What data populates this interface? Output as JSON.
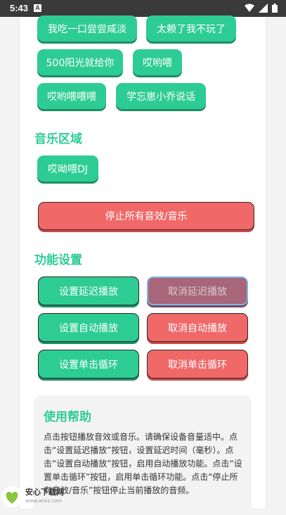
{
  "status_bar": {
    "time": "5:43",
    "notif_glyph": "A"
  },
  "sound_chips": [
    {
      "label": "我吃一口尝尝咸淡"
    },
    {
      "label": "太赖了我不玩了"
    },
    {
      "label": "500阳光就给你"
    },
    {
      "label": "哎哟喂"
    },
    {
      "label": "哎哟喂喂喂"
    },
    {
      "label": "学忘崽小乔说话"
    }
  ],
  "music_section": {
    "title": "音乐区域",
    "chips": [
      {
        "label": "哎呦喂DJ"
      }
    ],
    "stop_label": "停止所有音效/音乐"
  },
  "settings_section": {
    "title": "功能设置",
    "set_delay": "设置延迟播放",
    "cancel_delay": "取消延迟播放",
    "set_auto": "设置自动播放",
    "cancel_auto": "取消自动播放",
    "set_loop": "设置单击循环",
    "cancel_loop": "取消单击循环"
  },
  "help": {
    "title": "使用帮助",
    "text": "点击按钮播放音效或音乐。请确保设备音量适中。点击“设置延迟播放”按钮，设置延迟时间（毫秒）。点击“设置自动播放”按钮，启用自动播放功能。点击“设置单击循环”按钮，启用单击循环功能。点击“停止所有音效/音乐”按钮停止当前播放的音频。"
  },
  "watermark": {
    "brand": "安心下载网",
    "url": "www.anxz.com"
  },
  "colors": {
    "accent_green": "#2ecc95",
    "danger_red": "#f06868",
    "status_bar": "#3a3a3a"
  }
}
